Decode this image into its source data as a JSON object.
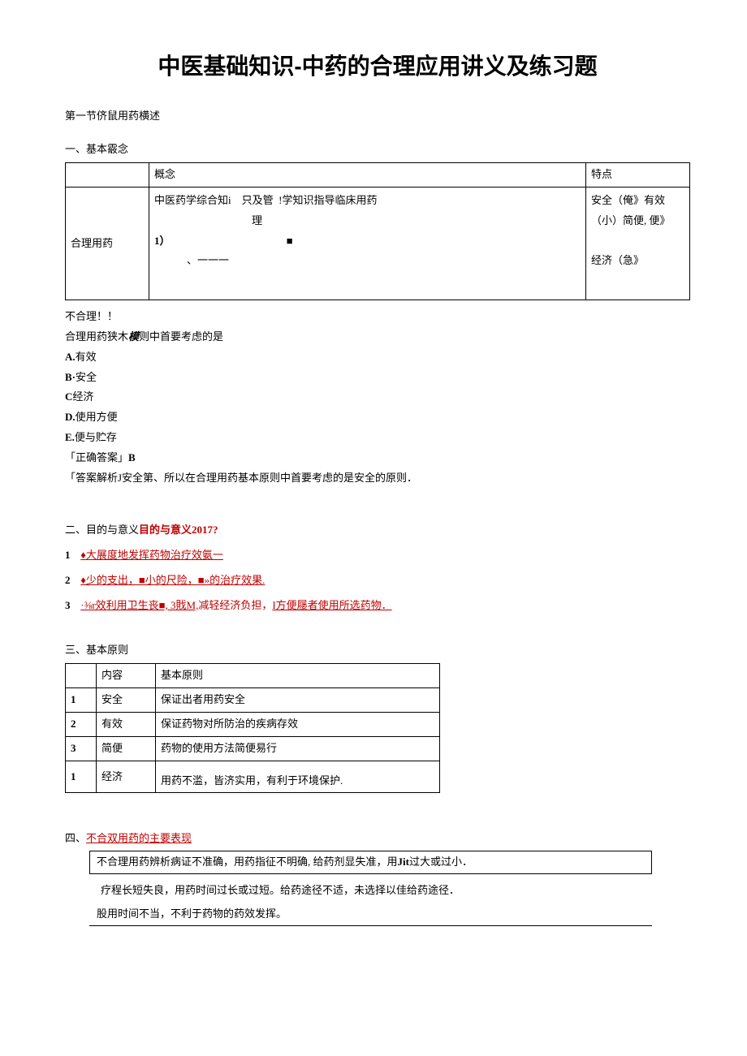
{
  "title": "中医基础知识-中药的合理应用讲义及练习题",
  "section1_label": "第一节侪鼠用药横述",
  "s1": {
    "heading": "一、基本霰念",
    "th_concept": "概念",
    "th_feature": "特点",
    "row_label": "合理用药",
    "concept_line1a": "中医药学综合知i",
    "concept_line1b": "只及管",
    "concept_line1c": "理",
    "concept_line1d": "!学知识指导临床用药",
    "concept_line2": "1）",
    "concept_line3": "、一一一",
    "feature_line1": "安全（俺》有效",
    "feature_line2": "（小）简便, 便》",
    "feature_line3": "经济（急》"
  },
  "after_table": "不合理！！",
  "q": {
    "stem_a": "合理用药狭木",
    "stem_b": "模",
    "stem_c": "则中首要考虑的是",
    "A": "A.有效",
    "B": "B·安全",
    "C": "C经济",
    "D": "D.使用方便",
    "E": "E.便与贮存",
    "ans_label": "「正确答案」",
    "ans_val": "B",
    "explain": "「答案解析J安全第、所以在合理用药基本原则中首要考虑的是安全的原则．"
  },
  "s2": {
    "heading_a": "二、目的与意义",
    "heading_b": "目的与意义2017?",
    "item1": "♦大展度地发挥药物治疗效氨一",
    "item2": "♦少的支出，■小的尺险，■»的治疗效果.",
    "item3_a": "·⅜r效利用卫生丧■, 3戝M,",
    "item3_b": "减轻经济负担，",
    "item3_c": "I方便屦者使用所选药物．"
  },
  "s3": {
    "heading": "三、基本原则",
    "th_content": "内容",
    "th_principle": "基本原则",
    "r1_n": "1",
    "r1_a": "安全",
    "r1_b": "保证出者用药安全",
    "r2_n": "2",
    "r2_a": "有效",
    "r2_b": "保证药物对所防治的疾病存效",
    "r3_n": "3",
    "r3_a": "简便",
    "r3_b": "药物的使用方法简便易行",
    "r4_n": "1",
    "r4_a": "经济",
    "r4_b": "用药不滥，皆济实用，有利于环境保护."
  },
  "s4": {
    "heading_a": "四、",
    "heading_b": "不合双用药的主要表现",
    "line1a": "不合理用药辨析病证不准确，用药指征不明确, 给药剂显失准，用",
    "line1b": "Jit",
    "line1c": "过大或过小．",
    "line2": "疗程长短失良，用药时间过长或过短。给药途径不适，未选择以佳给药途径．",
    "line3": "股用时间不当，不利于药物的药效发挥。"
  }
}
